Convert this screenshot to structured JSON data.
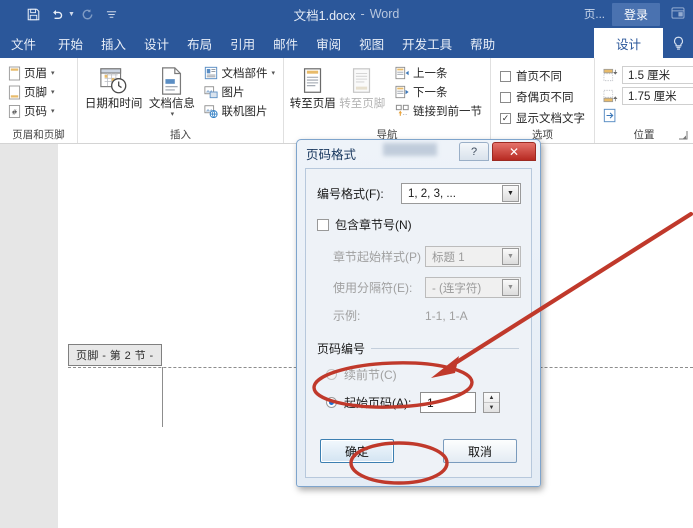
{
  "titlebar": {
    "quick_access": [
      {
        "name": "save-icon",
        "glyph": "Ὃe"
      },
      {
        "name": "undo-icon",
        "glyph": "↶"
      },
      {
        "name": "redo-icon",
        "glyph": "↻"
      },
      {
        "name": "customize-qat-icon",
        "glyph": "⌄"
      }
    ],
    "doc_title": "文档1.docx",
    "title_sep": "-",
    "app_name": "Word",
    "page_menu": "页...",
    "signin_label": "登录",
    "ribbon_display_icon": "⬚"
  },
  "tabs": [
    {
      "label": "文件",
      "active": false
    },
    {
      "label": "开始",
      "active": false
    },
    {
      "label": "插入",
      "active": false
    },
    {
      "label": "设计",
      "active": false
    },
    {
      "label": "布局",
      "active": false
    },
    {
      "label": "引用",
      "active": false
    },
    {
      "label": "邮件",
      "active": false
    },
    {
      "label": "审阅",
      "active": false
    },
    {
      "label": "视图",
      "active": false
    },
    {
      "label": "开发工具",
      "active": false
    },
    {
      "label": "帮助",
      "active": false
    },
    {
      "label": "设计",
      "active": true
    }
  ],
  "tellme_icon": "Ὂ1",
  "ribbon": {
    "groups": [
      {
        "name": "header-footer-group",
        "label": "页眉和页脚",
        "items": [
          {
            "label": "页眉",
            "caret": "▾"
          },
          {
            "label": "页脚",
            "caret": "▾"
          },
          {
            "label": "页码",
            "caret": "▾"
          }
        ]
      },
      {
        "name": "insert-group",
        "label": "插入",
        "big_buttons": [
          {
            "label": "日期和时间",
            "disabled": false
          },
          {
            "label": "文档信息",
            "caret": "▾",
            "disabled": false
          }
        ],
        "items": [
          {
            "label": "文档部件",
            "caret": "▾"
          },
          {
            "label": "图片",
            "caret": ""
          },
          {
            "label": "联机图片",
            "caret": ""
          }
        ]
      },
      {
        "name": "navigation-group",
        "label": "导航",
        "big_buttons": [
          {
            "label": "转至页眉",
            "disabled": false
          },
          {
            "label": "转至页脚",
            "disabled": true
          }
        ],
        "items": [
          {
            "label": "上一条"
          },
          {
            "label": "下一条"
          },
          {
            "label": "链接到前一节"
          }
        ]
      },
      {
        "name": "options-group",
        "label": "选项",
        "checkboxes": [
          {
            "label": "首页不同",
            "checked": false
          },
          {
            "label": "奇偶页不同",
            "checked": false
          },
          {
            "label": "显示文档文字",
            "checked": true
          }
        ]
      },
      {
        "name": "position-group",
        "label": "位置",
        "fields": [
          {
            "name": "header-from-top",
            "value": "1.5 厘米"
          },
          {
            "name": "footer-from-bottom",
            "value": "1.75 厘米"
          }
        ],
        "align_tab_icon": "⎣"
      }
    ]
  },
  "document": {
    "footer_tag": "页脚 - 第 2 节 -",
    "para_mark": "¶"
  },
  "dialog": {
    "title": "页码格式",
    "help_button": "?",
    "close_button": "✕",
    "number_format_label": "编号格式(F):",
    "number_format_label_key": "F",
    "number_format_value": "1, 2, 3, ...",
    "include_chapter_label": "包含章节号(N)",
    "include_chapter_checked": false,
    "chapter_style_label": "章节起始样式(P)",
    "chapter_style_value": "标题 1",
    "separator_label": "使用分隔符(E):",
    "separator_value": "-  (连字符)",
    "example_label": "示例:",
    "example_value": "1-1, 1-A",
    "page_numbering_group": "页码编号",
    "continue_label": "续前节(C)",
    "continue_selected": false,
    "start_at_label": "起始页码(A):",
    "start_at_selected": true,
    "start_at_value": "1",
    "spin_up": "▲",
    "spin_down": "▼",
    "ok_button": "确定",
    "cancel_button": "取消"
  },
  "annotations": {
    "color": "#c0392b",
    "arrow_name": "red-arrow-pointing-to-start-at",
    "ellipse1_name": "red-ellipse-start-at-row",
    "ellipse2_name": "red-ellipse-ok-button"
  },
  "colors": {
    "word_blue": "#2b579a",
    "ribbon_white": "#ffffff",
    "doc_gray": "#e6e6e6",
    "annotation_red": "#c0392b",
    "dialog_face": "#eef2f7"
  }
}
